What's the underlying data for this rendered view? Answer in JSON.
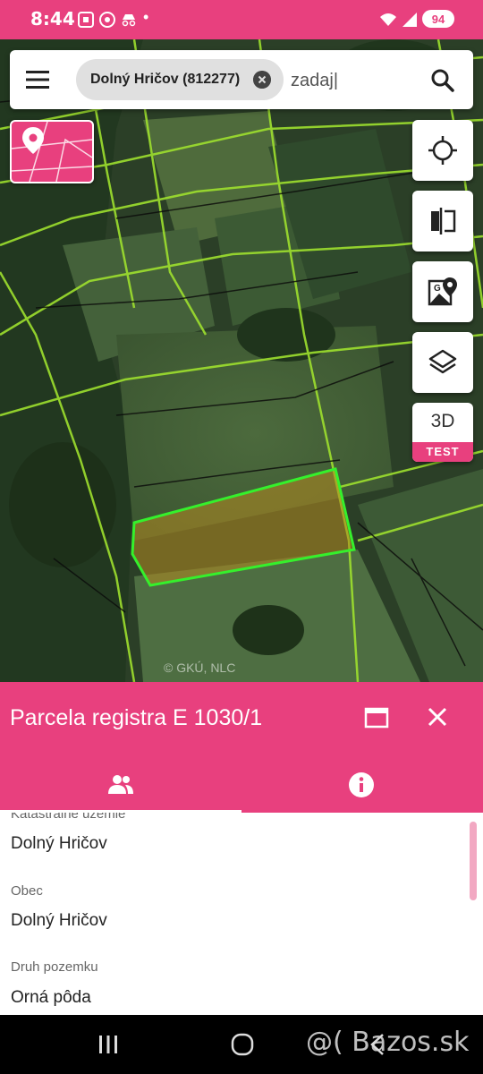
{
  "status_bar": {
    "time": "8:44",
    "battery": "94"
  },
  "map": {
    "copyright": "© GKÚ, NLC"
  },
  "search": {
    "chip_label": "Dolný Hričov (812277)",
    "input_value": "zadaj|"
  },
  "controls": {
    "btn_3d_label": "3D",
    "btn_3d_badge": "TEST"
  },
  "sheet": {
    "title": "Parcela registra E 1030/1",
    "fields": [
      {
        "label": "Katastrálne územie",
        "value": "Dolný Hričov"
      },
      {
        "label": "Obec",
        "value": "Dolný Hričov"
      },
      {
        "label": "Druh pozemku",
        "value": "Orná pôda"
      }
    ]
  },
  "watermark": "@( Bazos.sk",
  "colors": {
    "accent": "#e8407e",
    "parcel_outline": "#35f02c",
    "parcel_fill": "#b58a20"
  }
}
